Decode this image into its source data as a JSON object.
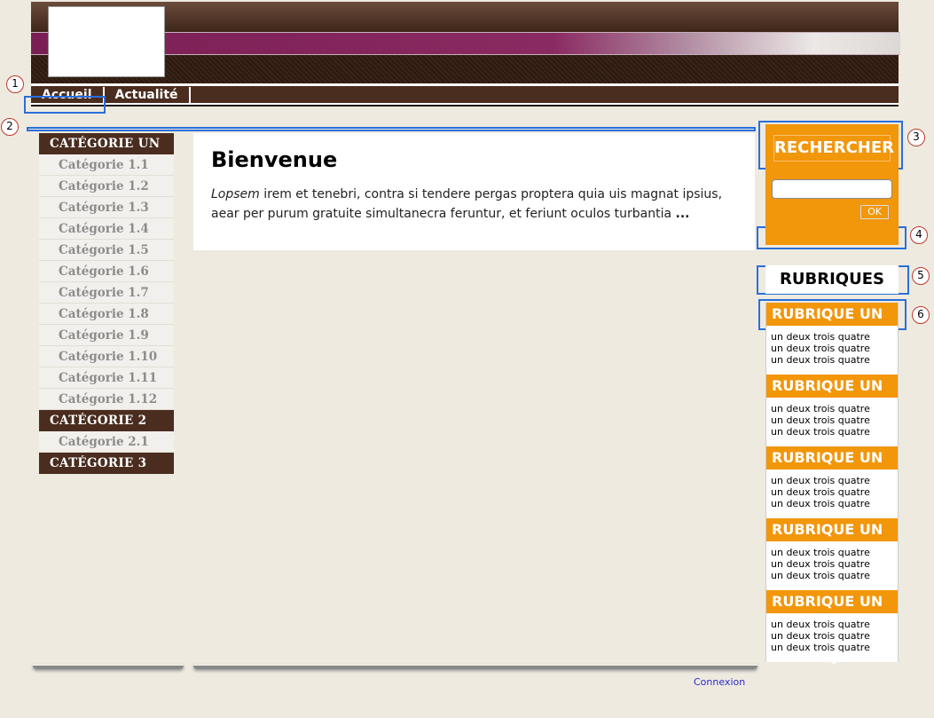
{
  "nav": {
    "items": [
      "Accueil",
      "Actualité"
    ]
  },
  "left_sidebar": {
    "groups": [
      {
        "title": "CATÉGORIE UN",
        "items": [
          "Catégorie 1.1",
          "Catégorie 1.2",
          "Catégorie 1.3",
          "Catégorie 1.4",
          "Catégorie 1.5",
          "Catégorie 1.6",
          "Catégorie 1.7",
          "Catégorie 1.8",
          "Catégorie 1.9",
          "Catégorie 1.10",
          "Catégorie 1.11",
          "Catégorie 1.12"
        ]
      },
      {
        "title": "CATÉGORIE 2",
        "items": [
          "Catégorie 2.1"
        ]
      },
      {
        "title": "CATÉGORIE 3",
        "items": []
      }
    ]
  },
  "main": {
    "title": "Bienvenue",
    "intro_em": "Lopsem",
    "intro_text": " irem et tenebri, contra si tendere pergas proptera quia uis magnat ipsius, aear per purum gratuite simultanecra feruntur, et feriunt oculos turbantia ",
    "intro_more": "..."
  },
  "search": {
    "title": "RECHERCHER",
    "input_value": "",
    "ok_label": "OK"
  },
  "rubriques": {
    "title": "RUBRIQUES",
    "blocks": [
      {
        "title": "RUBRIQUE UN",
        "lines": [
          "un deux trois quatre",
          "un deux trois quatre",
          "un deux trois quatre"
        ]
      },
      {
        "title": "RUBRIQUE UN",
        "lines": [
          "un deux trois quatre",
          "un deux trois quatre",
          "un deux trois quatre"
        ]
      },
      {
        "title": "RUBRIQUE UN",
        "lines": [
          "un deux trois quatre",
          "un deux trois quatre",
          "un deux trois quatre"
        ]
      },
      {
        "title": "RUBRIQUE UN",
        "lines": [
          "un deux trois quatre",
          "un deux trois quatre",
          "un deux trois quatre"
        ]
      },
      {
        "title": "RUBRIQUE UN",
        "lines": [
          "un deux trois quatre",
          "un deux trois quatre",
          "un deux trois quatre"
        ]
      }
    ]
  },
  "footer": {
    "login_label": "Connexion"
  },
  "annotations": [
    "1",
    "2",
    "3",
    "4",
    "5",
    "6"
  ],
  "colors": {
    "brown": "#4a2d1f",
    "orange": "#f2960a",
    "purple": "#7a1f55",
    "highlight": "#2a6fdb"
  }
}
